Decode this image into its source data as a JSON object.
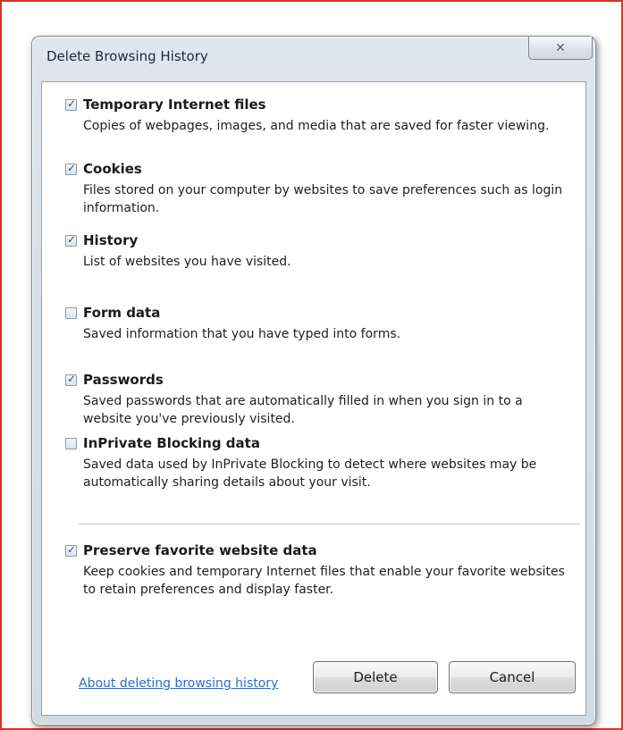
{
  "dialog": {
    "title": "Delete Browsing History",
    "close_glyph": "✕"
  },
  "options": [
    {
      "label": "Temporary Internet files",
      "checked": true,
      "description": "Copies of webpages, images, and media that are saved for faster viewing."
    },
    {
      "label": "Cookies",
      "checked": true,
      "description": "Files stored on your computer by websites to save preferences such as login information."
    },
    {
      "label": "History",
      "checked": true,
      "description": "List of websites you have visited."
    },
    {
      "label": "Form data",
      "checked": false,
      "description": "Saved information that you have typed into forms."
    },
    {
      "label": "Passwords",
      "checked": true,
      "description": "Saved passwords that are automatically filled in when you sign in to a website you've previously visited."
    },
    {
      "label": "InPrivate Blocking data",
      "checked": false,
      "description": "Saved data used by InPrivate Blocking to detect where websites may be automatically sharing details about your visit."
    },
    {
      "label": "Preserve favorite website data",
      "checked": true,
      "description": "Keep cookies and temporary Internet files that enable your favorite websites to retain preferences and display faster."
    }
  ],
  "footer": {
    "link_text": "About deleting browsing history",
    "delete_label": "Delete",
    "cancel_label": "Cancel"
  },
  "colors": {
    "frame_border": "#e0301e",
    "link": "#2a6ecb",
    "check": "#2b4f8a"
  }
}
